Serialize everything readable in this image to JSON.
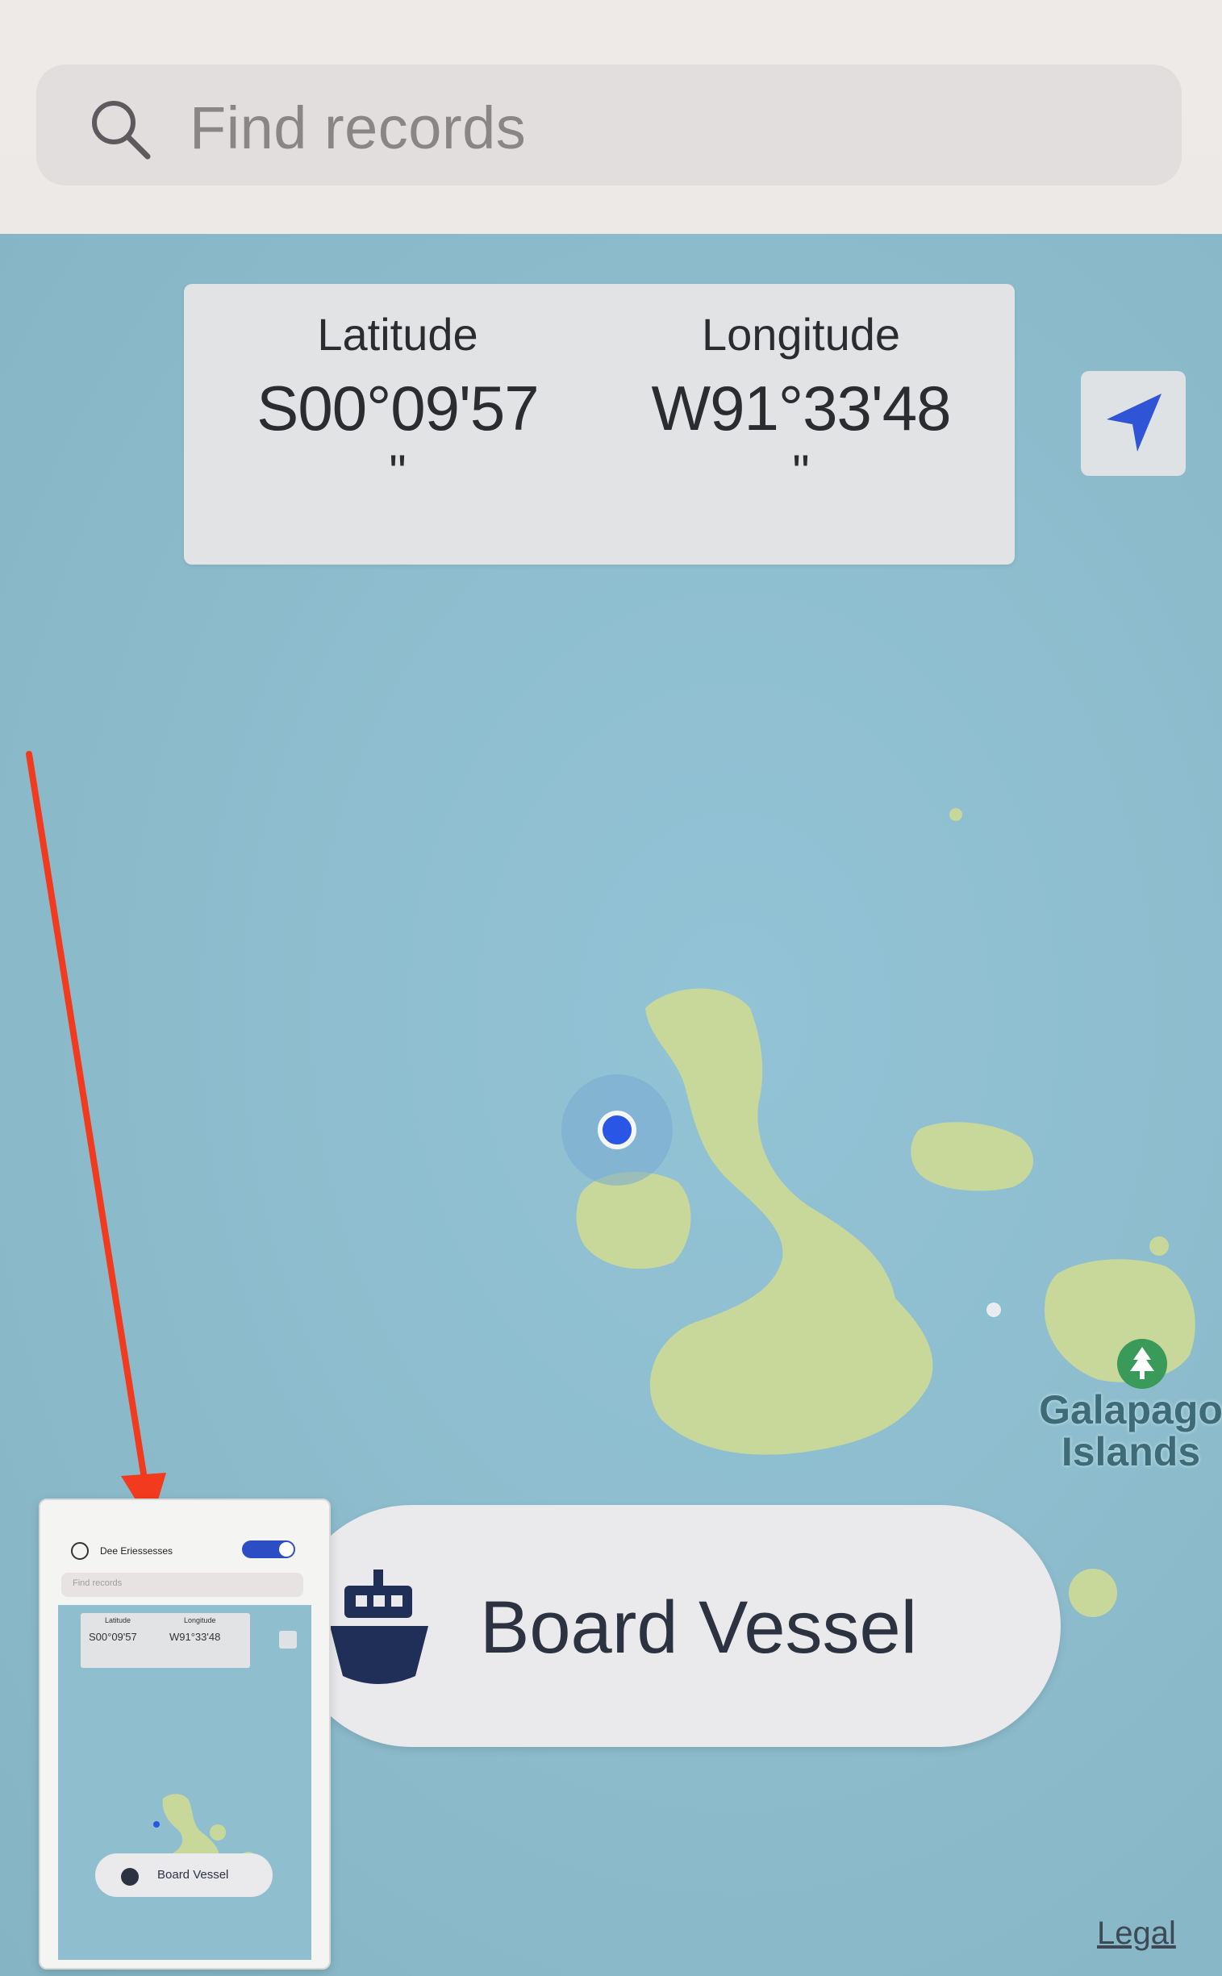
{
  "search": {
    "placeholder": "Find records"
  },
  "coordinates": {
    "latitude_label": "Latitude",
    "latitude_value": "S00°09'57",
    "latitude_suffix": "\"",
    "longitude_label": "Longitude",
    "longitude_value": "W91°33'48",
    "longitude_suffix": "\""
  },
  "locate_button": {
    "icon": "location-arrow-icon"
  },
  "map": {
    "poi_icon": "tree-icon",
    "poi_label_line1": "Galapago",
    "poi_label_line2": "Islands",
    "user_location_icon": "user-location-dot"
  },
  "board_button": {
    "label": "Board Vessel",
    "icon": "ship-icon"
  },
  "legal": {
    "label": "Legal"
  },
  "thumbnail": {
    "user_name": "Dee Eriessesses",
    "search_placeholder": "Find records",
    "latitude_label": "Latitude",
    "latitude_value": "S00°09'57",
    "longitude_label": "Longitude",
    "longitude_value": "W91°33'48",
    "board_label": "Board Vessel"
  },
  "colors": {
    "water": "#8fbfcf",
    "land": "#c8d89a",
    "accent_blue": "#2a56e6",
    "annotation_red": "#f23a1e",
    "text_dark": "#2c3240"
  }
}
